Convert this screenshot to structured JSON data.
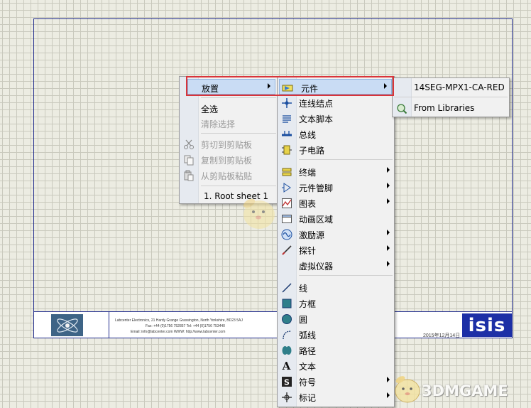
{
  "title_block": {
    "line1": "Labcenter Electronics,     21 Hardy Grange     Grassington,    North Yorkshire,     BD23 5AJ",
    "line2": "Fax: +44 (0)1756 752857          Tel: +44 (0)1756 753440",
    "line3": "Email:   info@labcenter.com          WWW:    http://www.labcenter.com",
    "date": "2015年12月14日",
    "brand": "isis"
  },
  "context_menu": {
    "items": [
      {
        "label": "放置",
        "has_submenu": true,
        "highlighted": true
      },
      {
        "label": "全选"
      },
      {
        "label": "清除选择",
        "disabled": true
      },
      {
        "label": "剪切到剪贴板",
        "icon": "scissors-icon",
        "disabled": true
      },
      {
        "label": "复制到剪贴板",
        "icon": "copy-icon",
        "disabled": true
      },
      {
        "label": "从剪贴板粘贴",
        "icon": "paste-icon",
        "disabled": true
      },
      {
        "label": "1. Root sheet 1"
      }
    ]
  },
  "place_menu": {
    "items": [
      {
        "label": "元件",
        "icon": "component-icon",
        "has_submenu": true,
        "highlighted": true
      },
      {
        "label": "连线结点",
        "icon": "junction-icon"
      },
      {
        "label": "文本脚本",
        "icon": "text-script-icon"
      },
      {
        "label": "总线",
        "icon": "bus-icon"
      },
      {
        "label": "子电路",
        "icon": "subcircuit-icon"
      },
      {
        "label": "终端",
        "icon": "terminal-icon",
        "has_submenu": true
      },
      {
        "label": "元件管脚",
        "icon": "device-pin-icon",
        "has_submenu": true
      },
      {
        "label": "图表",
        "icon": "graph-icon",
        "has_submenu": true
      },
      {
        "label": "动画区域",
        "icon": "tape-icon"
      },
      {
        "label": "激励源",
        "icon": "generator-icon",
        "has_submenu": true
      },
      {
        "label": "探针",
        "icon": "probe-icon",
        "has_submenu": true
      },
      {
        "label": "虚拟仪器",
        "icon": "instrument-icon",
        "has_submenu": true
      },
      {
        "label": "线",
        "icon": "line-icon"
      },
      {
        "label": "方框",
        "icon": "box-icon"
      },
      {
        "label": "圆",
        "icon": "circle-icon"
      },
      {
        "label": "弧线",
        "icon": "arc-icon"
      },
      {
        "label": "路径",
        "icon": "path-icon"
      },
      {
        "label": "文本",
        "icon": "text-icon"
      },
      {
        "label": "符号",
        "icon": "symbol-icon",
        "has_submenu": true
      },
      {
        "label": "标记",
        "icon": "marker-icon",
        "has_submenu": true
      }
    ]
  },
  "component_menu": {
    "items": [
      {
        "label": "14SEG-MPX1-CA-RED"
      },
      {
        "label": "From Libraries",
        "icon": "library-search-icon"
      }
    ]
  },
  "watermark": {
    "text": "3DMGAME"
  },
  "colors": {
    "highlight": "#c9dcf4",
    "annotation_red": "#d9343a",
    "sheet_border": "#1f2a8c",
    "brand_blue": "#1c2fa6"
  }
}
